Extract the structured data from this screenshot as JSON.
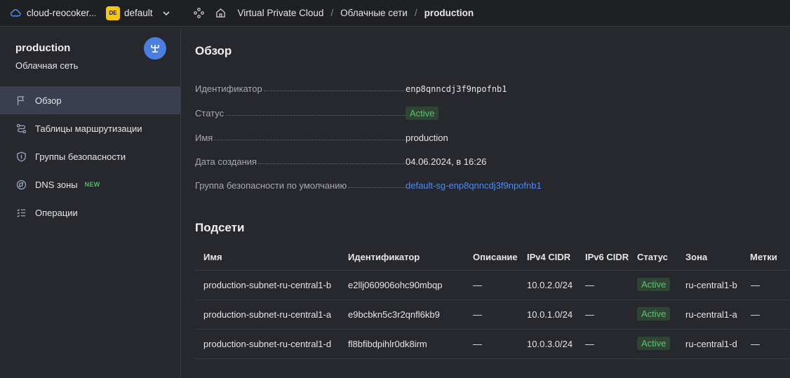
{
  "topbar": {
    "cloud_name": "cloud-reocoker...",
    "folder_badge": "DE",
    "folder_name": "default",
    "breadcrumb": [
      "Virtual Private Cloud",
      "Облачные сети",
      "production"
    ],
    "separator": "/"
  },
  "sidebar": {
    "title": "production",
    "subtitle": "Облачная сеть",
    "items": [
      {
        "label": "Обзор",
        "icon": "flag-icon",
        "active": true
      },
      {
        "label": "Таблицы маршрутизации",
        "icon": "route-icon"
      },
      {
        "label": "Группы безопасности",
        "icon": "shield-icon"
      },
      {
        "label": "DNS зоны",
        "icon": "dns-icon",
        "badge": "NEW"
      },
      {
        "label": "Операции",
        "icon": "list-icon"
      }
    ]
  },
  "overview": {
    "title": "Обзор",
    "fields": [
      {
        "key": "Идентификатор",
        "value": "enp8qnncdj3f9npofnb1"
      },
      {
        "key": "Статус",
        "value": "Active"
      },
      {
        "key": "Имя",
        "value": "production"
      },
      {
        "key": "Дата создания",
        "value": "04.06.2024, в 16:26"
      },
      {
        "key": "Группа безопасности по умолчанию",
        "value": "default-sg-enp8qnncdj3f9npofnb1"
      }
    ]
  },
  "subnets": {
    "title": "Подсети",
    "columns": [
      "Имя",
      "Идентификатор",
      "Описание",
      "IPv4 CIDR",
      "IPv6 CIDR",
      "Статус",
      "Зона",
      "Метки"
    ],
    "rows": [
      [
        "production-subnet-ru-central1-b",
        "e2llj060906ohc90mbqp",
        "—",
        "10.0.2.0/24",
        "—",
        "Active",
        "ru-central1-b",
        "—"
      ],
      [
        "production-subnet-ru-central1-a",
        "e9bcbkn5c3r2qnfl6kb9",
        "—",
        "10.0.1.0/24",
        "—",
        "Active",
        "ru-central1-a",
        "—"
      ],
      [
        "production-subnet-ru-central1-d",
        "fl8bfibdpihlr0dk8irm",
        "—",
        "10.0.3.0/24",
        "—",
        "Active",
        "ru-central1-d",
        "—"
      ]
    ]
  },
  "colors": {
    "background": "#27282d",
    "active_nav": "#3a4050",
    "link": "#4d8bf5",
    "status_green": "#5cc273",
    "folder_badge": "#f5c518",
    "avatar": "#4c7de0"
  }
}
